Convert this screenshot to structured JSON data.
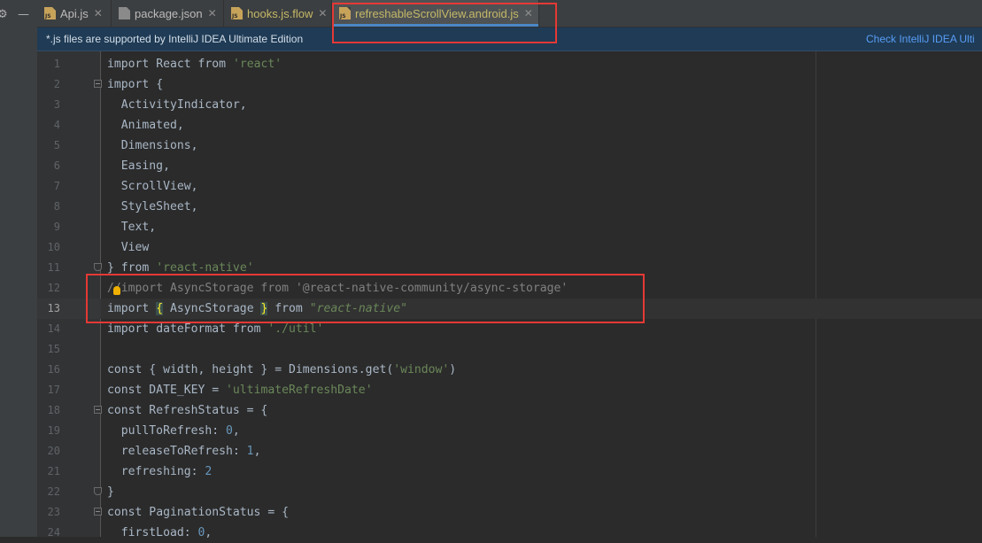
{
  "tabs": [
    {
      "label": "Api.js",
      "icon": "js-file-icon",
      "active": false
    },
    {
      "label": "package.json",
      "icon": "json-file-icon",
      "active": false
    },
    {
      "label": "hooks.js.flow",
      "icon": "js-file-icon",
      "active": false
    },
    {
      "label": "refreshableScrollView.android.js",
      "icon": "js-file-icon",
      "active": true
    }
  ],
  "banner": {
    "message": "*.js files are supported by IntelliJ IDEA Ultimate Edition",
    "link": "Check IntelliJ IDEA Ulti"
  },
  "editor": {
    "current_line": 13,
    "lines": [
      {
        "n": "1",
        "text": "import React from 'react'"
      },
      {
        "n": "2",
        "text": "import {"
      },
      {
        "n": "3",
        "text": "  ActivityIndicator,"
      },
      {
        "n": "4",
        "text": "  Animated,"
      },
      {
        "n": "5",
        "text": "  Dimensions,"
      },
      {
        "n": "6",
        "text": "  Easing,"
      },
      {
        "n": "7",
        "text": "  ScrollView,"
      },
      {
        "n": "8",
        "text": "  StyleSheet,"
      },
      {
        "n": "9",
        "text": "  Text,"
      },
      {
        "n": "10",
        "text": "  View"
      },
      {
        "n": "11",
        "text": "} from 'react-native'"
      },
      {
        "n": "12",
        "text": "//import AsyncStorage from '@react-native-community/async-storage'"
      },
      {
        "n": "13",
        "text": "import { AsyncStorage } from \"react-native\""
      },
      {
        "n": "14",
        "text": "import dateFormat from './util'"
      },
      {
        "n": "15",
        "text": ""
      },
      {
        "n": "16",
        "text": "const { width, height } = Dimensions.get('window')"
      },
      {
        "n": "17",
        "text": "const DATE_KEY = 'ultimateRefreshDate'"
      },
      {
        "n": "18",
        "text": "const RefreshStatus = {"
      },
      {
        "n": "19",
        "text": "  pullToRefresh: 0,"
      },
      {
        "n": "20",
        "text": "  releaseToRefresh: 1,"
      },
      {
        "n": "21",
        "text": "  refreshing: 2"
      },
      {
        "n": "22",
        "text": "}"
      },
      {
        "n": "23",
        "text": "const PaginationStatus = {"
      },
      {
        "n": "24",
        "text": "  firstLoad: 0,"
      }
    ]
  },
  "colors": {
    "keyword": "#cc7832",
    "string": "#6a8759",
    "number": "#6897bb",
    "comment": "#808080",
    "highlight_box": "#e53935"
  }
}
